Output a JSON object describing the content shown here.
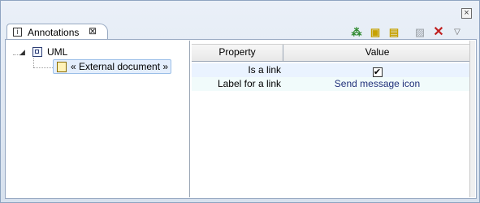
{
  "view": {
    "tab_label": "Annotations",
    "tab_close_glyph": "⊠",
    "window_close_glyph": "×",
    "toolbar_icons": [
      "add-annotation-icon",
      "annotation-yellow-icon",
      "annotation-yellow-add-icon",
      "disabled-edit-icon",
      "delete-icon",
      "view-menu-icon"
    ]
  },
  "tree": {
    "root": {
      "label": "UML",
      "expanded": true,
      "twisty": "◢"
    },
    "child": {
      "label": "« External document »"
    }
  },
  "properties": {
    "headers": [
      "Property",
      "Value"
    ],
    "rows": [
      {
        "property": "Is a link",
        "value": "✔"
      },
      {
        "property": "Label for a link",
        "value": "Send message icon"
      }
    ]
  }
}
